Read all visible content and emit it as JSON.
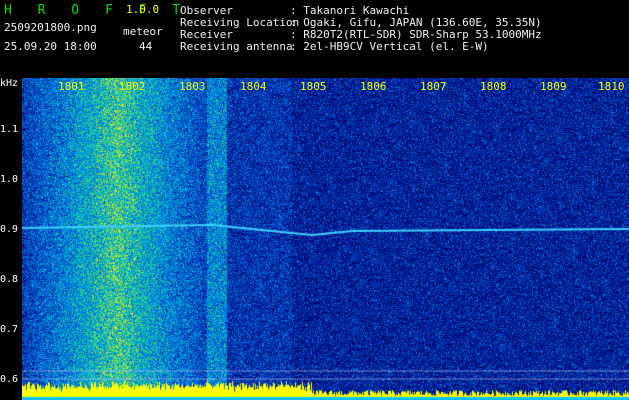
{
  "app": {
    "title": "H R O F F T",
    "version": "1.0.0"
  },
  "file": {
    "name": "2509201800.png",
    "datetime": "25.09.20 18:00"
  },
  "meteor": {
    "label": "meteor",
    "count": "44"
  },
  "info": {
    "observer_label": "Observer",
    "observer_value": ": Takanori Kawachi",
    "location_label": "Receiving Location",
    "location_value": ": Ogaki, Gifu, JAPAN (136.60E, 35.35N)",
    "receiver_label": "Receiver",
    "receiver_value": ": R820T2(RTL-SDR) SDR-Sharp 53.1000MHz",
    "antenna_label": "Receiving antenna",
    "antenna_value": ": 2el-HB9CV Vertical (el. E-W)"
  },
  "axis": {
    "y_unit": "kHz",
    "y_ticks": [
      "1.1",
      "1.0",
      "0.9",
      "0.8",
      "0.7",
      "0.6"
    ],
    "x_ticks": [
      "1801",
      "1802",
      "1803",
      "1804",
      "1805",
      "1806",
      "1807",
      "1808",
      "1809",
      "1810"
    ]
  },
  "colors": {
    "background": "#000000",
    "header_text": "#ffffff",
    "title": "#00e000",
    "tick": "#ffff00",
    "noise": "#0a1a8a",
    "signal": "#40c0ff"
  }
}
